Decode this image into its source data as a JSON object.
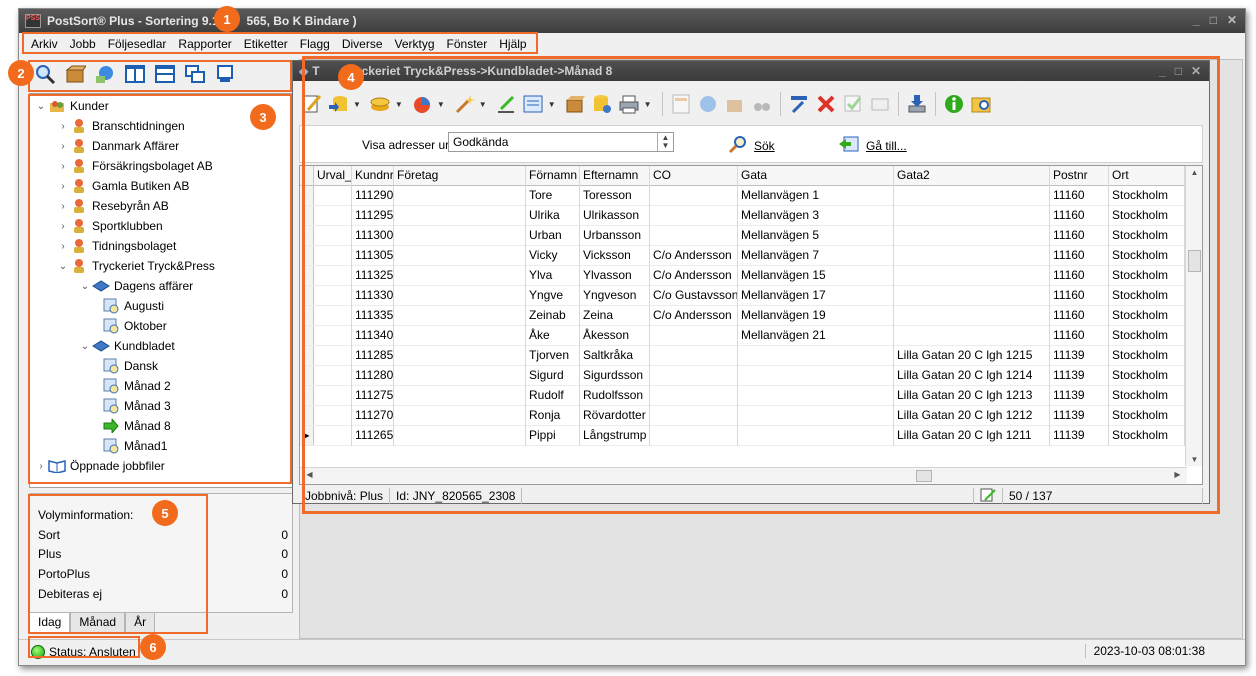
{
  "app": {
    "title": "PostSort® Plus - Sortering 9.1",
    "title_suffix": "565, Bo K Bindare )",
    "logo_text": "PSS"
  },
  "menu": [
    "Arkiv",
    "Jobb",
    "Följesedlar",
    "Rapporter",
    "Etiketter",
    "Flagg",
    "Diverse",
    "Verktyg",
    "Fönster",
    "Hjälp"
  ],
  "tree": {
    "root": "Kunder",
    "customers": [
      "Branschtidningen",
      "Danmark Affärer",
      "Försäkringsbolaget AB",
      "Gamla Butiken AB",
      "Resebyrån AB",
      "Sportklubben",
      "Tidningsbolaget",
      "Tryckeriet Tryck&Press"
    ],
    "pub1": "Dagens affärer",
    "pub1_items": [
      "Augusti",
      "Oktober"
    ],
    "pub2": "Kundbladet",
    "pub2_items": [
      "Dansk",
      "Månad 2",
      "Månad 3",
      "Månad 8",
      "Månad1"
    ],
    "opened": "Öppnade jobbfiler"
  },
  "volume": {
    "header": "Volyminformation:",
    "rows": [
      {
        "label": "Sort",
        "value": "0"
      },
      {
        "label": "Plus",
        "value": "0"
      },
      {
        "label": "PortoPlus",
        "value": "0"
      },
      {
        "label": "Debiteras ej",
        "value": "0"
      }
    ],
    "tabs": [
      "Idag",
      "Månad",
      "År"
    ]
  },
  "status": {
    "text": "Status: Ansluten",
    "datetime": "2023-10-03 08:01:38"
  },
  "child": {
    "title": "Tryckeriet Tryck&Press->Kundbladet->Månad 8",
    "title_prefix": "T",
    "filter_label": "Visa adresser ur:",
    "filter_value": "Godkända",
    "search_label": "Sök",
    "goto_label": "Gå till...",
    "columns": [
      "Urval_",
      "Kundnr",
      "Företag",
      "Förnamn",
      "Efternamn",
      "CO",
      "Gata",
      "Gata2",
      "Postnr",
      "Ort"
    ],
    "rows": [
      [
        "",
        "111290",
        "",
        "Tore",
        "Toresson",
        "",
        "Mellanvägen 1",
        "",
        "11160",
        "Stockholm"
      ],
      [
        "",
        "111295",
        "",
        "Ulrika",
        "Ulrikasson",
        "",
        "Mellanvägen 3",
        "",
        "11160",
        "Stockholm"
      ],
      [
        "",
        "111300",
        "",
        "Urban",
        "Urbansson",
        "",
        "Mellanvägen 5",
        "",
        "11160",
        "Stockholm"
      ],
      [
        "",
        "111305",
        "",
        "Vicky",
        "Vicksson",
        "C/o Andersson",
        "Mellanvägen 7",
        "",
        "11160",
        "Stockholm"
      ],
      [
        "",
        "111325",
        "",
        "Ylva",
        "Ylvasson",
        "C/o Andersson",
        "Mellanvägen 15",
        "",
        "11160",
        "Stockholm"
      ],
      [
        "",
        "111330",
        "",
        "Yngve",
        "Yngveson",
        "C/o Gustavsson",
        "Mellanvägen 17",
        "",
        "11160",
        "Stockholm"
      ],
      [
        "",
        "111335",
        "",
        "Zeinab",
        "Zeina",
        "C/o Andersson",
        "Mellanvägen 19",
        "",
        "11160",
        "Stockholm"
      ],
      [
        "",
        "111340",
        "",
        "Åke",
        "Åkesson",
        "",
        "Mellanvägen 21",
        "",
        "11160",
        "Stockholm"
      ],
      [
        "",
        "111285",
        "",
        "Tjorven",
        "Saltkråka",
        "",
        "",
        "Lilla Gatan 20 C lgh 1215",
        "11139",
        "Stockholm"
      ],
      [
        "",
        "111280",
        "",
        "Sigurd",
        "Sigurdsson",
        "",
        "",
        "Lilla Gatan 20 C lgh 1214",
        "11139",
        "Stockholm"
      ],
      [
        "",
        "111275",
        "",
        "Rudolf",
        "Rudolfsson",
        "",
        "",
        "Lilla Gatan 20 C lgh 1213",
        "11139",
        "Stockholm"
      ],
      [
        "",
        "111270",
        "",
        "Ronja",
        "Rövardotter",
        "",
        "",
        "Lilla Gatan 20 C lgh 1212",
        "11139",
        "Stockholm"
      ],
      [
        "",
        "111265",
        "",
        "Pippi",
        "Långstrump",
        "",
        "",
        "Lilla Gatan 20 C lgh 1211",
        "11139",
        "Stockholm"
      ]
    ],
    "current_row_marker": "▶",
    "job_level": "Jobbnivå: Plus",
    "job_id": "Id: JNY_820565_2308",
    "record_count": "50 / 137"
  },
  "badges": [
    "1",
    "2",
    "3",
    "4",
    "5",
    "6"
  ],
  "colors": {
    "accent": "#f06a2a",
    "titlebar": "#3e3e3e",
    "status_ok": "#1a9c0a"
  }
}
